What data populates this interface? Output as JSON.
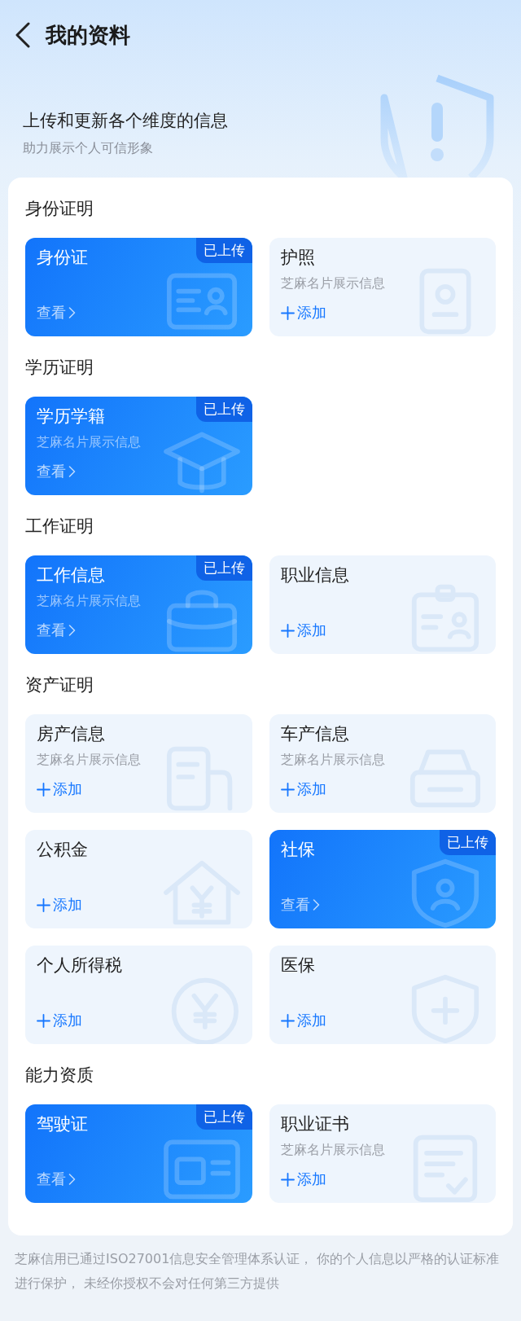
{
  "header": {
    "title": "我的资料"
  },
  "hero": {
    "title": "上传和更新各个维度的信息",
    "subtitle": "助力展示个人可信形象"
  },
  "sections": [
    {
      "title": "身份证明",
      "cards": [
        {
          "title": "身份证",
          "uploaded": true,
          "badge": "已上传",
          "action": "查看"
        },
        {
          "title": "护照",
          "subtitle": "芝麻名片展示信息",
          "uploaded": false,
          "action": "添加"
        }
      ]
    },
    {
      "title": "学历证明",
      "cards": [
        {
          "title": "学历学籍",
          "subtitle": "芝麻名片展示信息",
          "uploaded": true,
          "badge": "已上传",
          "action": "查看"
        }
      ]
    },
    {
      "title": "工作证明",
      "cards": [
        {
          "title": "工作信息",
          "subtitle": "芝麻名片展示信息",
          "uploaded": true,
          "badge": "已上传",
          "action": "查看"
        },
        {
          "title": "职业信息",
          "uploaded": false,
          "action": "添加"
        }
      ]
    },
    {
      "title": "资产证明",
      "cards": [
        {
          "title": "房产信息",
          "subtitle": "芝麻名片展示信息",
          "uploaded": false,
          "action": "添加"
        },
        {
          "title": "车产信息",
          "subtitle": "芝麻名片展示信息",
          "uploaded": false,
          "action": "添加"
        },
        {
          "title": "公积金",
          "uploaded": false,
          "action": "添加"
        },
        {
          "title": "社保",
          "uploaded": true,
          "badge": "已上传",
          "action": "查看"
        },
        {
          "title": "个人所得税",
          "uploaded": false,
          "action": "添加"
        },
        {
          "title": "医保",
          "uploaded": false,
          "action": "添加"
        }
      ]
    },
    {
      "title": "能力资质",
      "cards": [
        {
          "title": "驾驶证",
          "uploaded": true,
          "badge": "已上传",
          "action": "查看"
        },
        {
          "title": "职业证书",
          "subtitle": "芝麻名片展示信息",
          "uploaded": false,
          "action": "添加"
        }
      ]
    }
  ],
  "footer": "芝麻信用已通过ISO27001信息安全管理体系认证， 你的个人信息以严格的认证标准进行保护， 未经你授权不会对任何第三方提供"
}
